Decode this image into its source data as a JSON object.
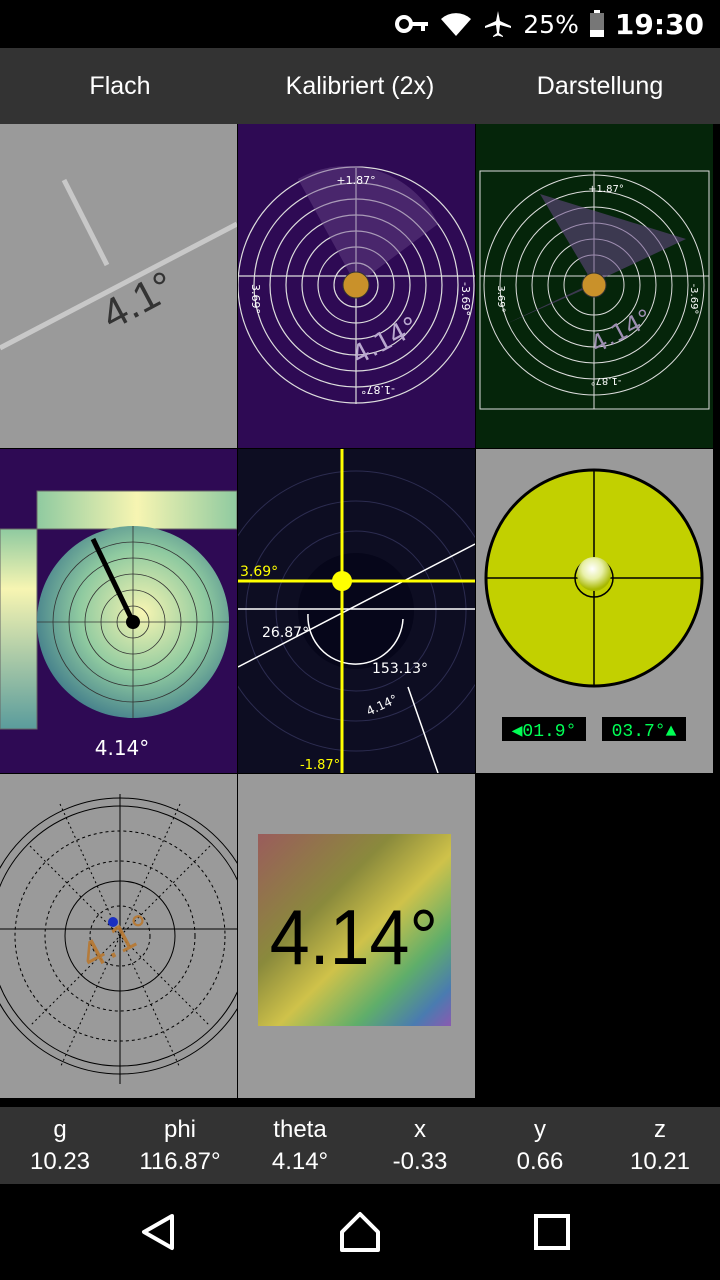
{
  "status": {
    "battery": "25%",
    "time": "19:30"
  },
  "tabs": [
    "Flach",
    "Kalibriert (2x)",
    "Darstellung"
  ],
  "tiles": {
    "flat": {
      "angle": "4.1°"
    },
    "polar_purple": {
      "angle": "4.14°",
      "top": "+1.87°",
      "bottom": "-1.87°",
      "left": "3.69°",
      "right": "-3.69°"
    },
    "polar_green": {
      "angle": "4.14°",
      "top": "+1.87°",
      "bottom": "-1.87°",
      "left": "3.69°",
      "right": "-3.69°"
    },
    "bubble_gradient": {
      "angle": "4.14°"
    },
    "crosshair": {
      "y_label": "3.69°",
      "a1": "26.87°",
      "a2": "153.13°",
      "theta": "4.14°",
      "bottom": "-1.87°"
    },
    "bullseye": {
      "left": "◀01.9°",
      "right": "03.7°▲"
    },
    "sphere": {
      "angle": "4.1°"
    },
    "rainbow": {
      "angle": "4.14°"
    }
  },
  "readings": [
    {
      "label": "g",
      "value": "10.23"
    },
    {
      "label": "phi",
      "value": "116.87°"
    },
    {
      "label": "theta",
      "value": "4.14°"
    },
    {
      "label": "x",
      "value": "-0.33"
    },
    {
      "label": "y",
      "value": "0.66"
    },
    {
      "label": "z",
      "value": "10.21"
    }
  ],
  "icons": {
    "status": [
      "key-icon",
      "wifi-icon",
      "airplane-icon",
      "battery-icon"
    ],
    "nav": [
      "back-icon",
      "home-icon",
      "recents-icon"
    ]
  }
}
